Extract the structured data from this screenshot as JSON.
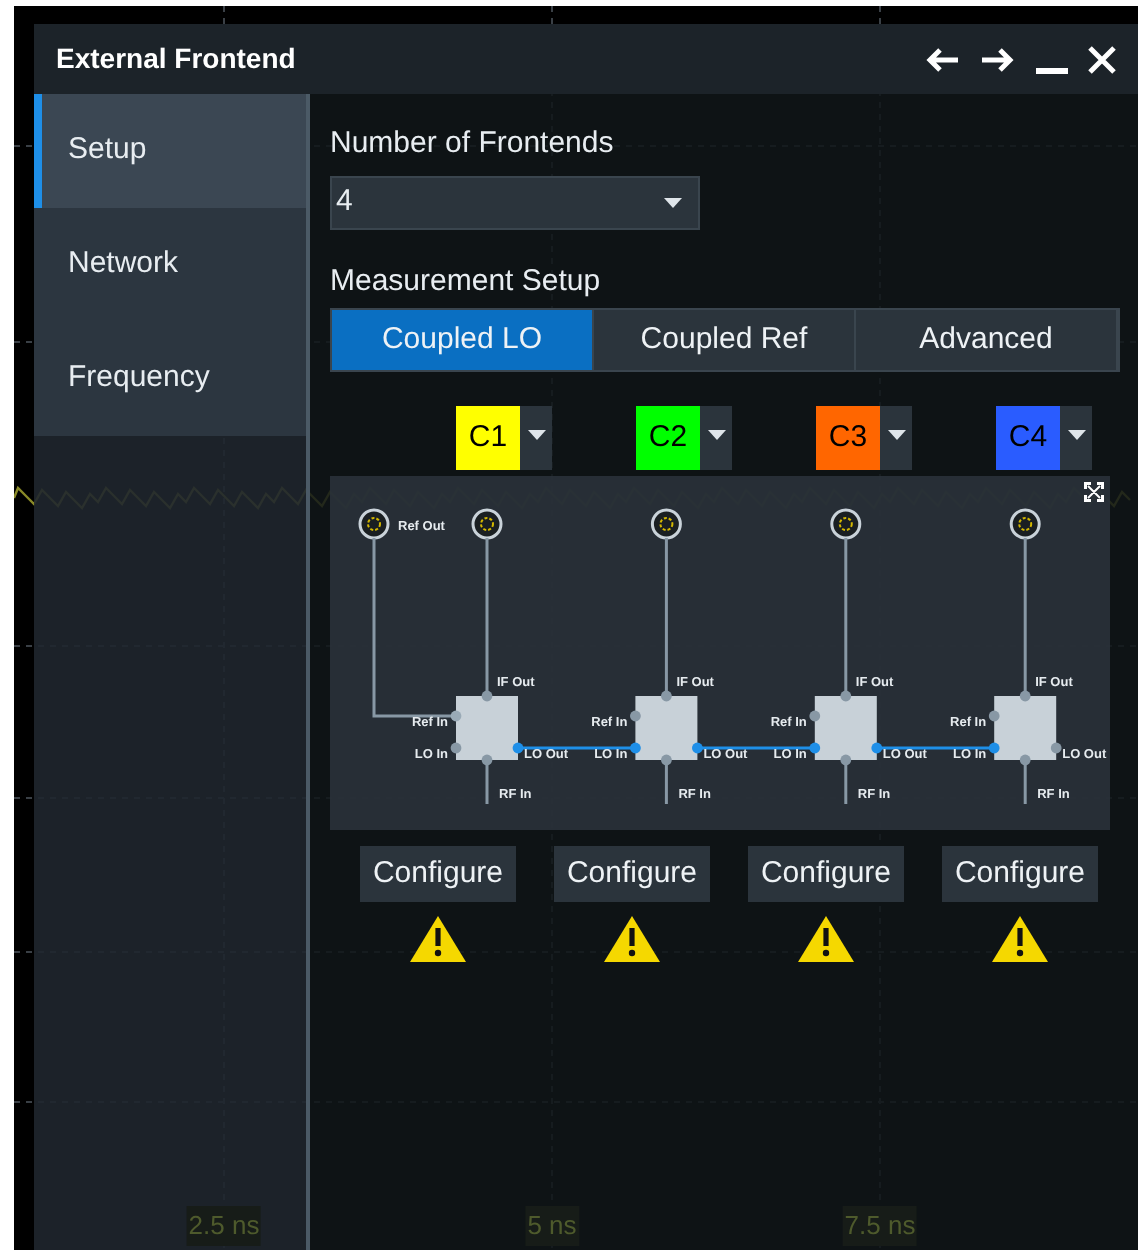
{
  "window": {
    "title": "External Frontend"
  },
  "sidebar": {
    "items": [
      {
        "label": "Setup",
        "selected": true
      },
      {
        "label": "Network",
        "selected": false
      },
      {
        "label": "Frequency",
        "selected": false
      }
    ]
  },
  "number_of_frontends": {
    "label": "Number of Frontends",
    "value": "4"
  },
  "measurement_setup": {
    "label": "Measurement Setup",
    "tabs": [
      {
        "label": "Coupled LO",
        "selected": true
      },
      {
        "label": "Coupled Ref",
        "selected": false
      },
      {
        "label": "Advanced",
        "selected": false
      }
    ]
  },
  "diagram": {
    "ref_out": "Ref Out",
    "frontends": [
      {
        "channel": "C1",
        "color": "#ffff00",
        "if_out": "IF Out",
        "ref_in": "Ref In",
        "lo_in": "LO In",
        "lo_out": "LO Out",
        "rf_in": "RF In",
        "ref_connected": true,
        "lo_out_connected": true,
        "button": "Configure",
        "warning": true
      },
      {
        "channel": "C2",
        "color": "#00ff00",
        "if_out": "IF Out",
        "ref_in": "Ref In",
        "lo_in": "LO In",
        "lo_out": "LO Out",
        "rf_in": "RF In",
        "ref_connected": false,
        "lo_out_connected": true,
        "button": "Configure",
        "warning": true
      },
      {
        "channel": "C3",
        "color": "#ff6600",
        "if_out": "IF Out",
        "ref_in": "Ref In",
        "lo_in": "LO In",
        "lo_out": "LO Out",
        "rf_in": "RF In",
        "ref_connected": false,
        "lo_out_connected": true,
        "button": "Configure",
        "warning": true
      },
      {
        "channel": "C4",
        "color": "#2a5cff",
        "if_out": "IF Out",
        "ref_in": "Ref In",
        "lo_in": "LO In",
        "lo_out": "LO Out",
        "rf_in": "RF In",
        "ref_connected": false,
        "lo_out_connected": false,
        "button": "Configure",
        "warning": true
      }
    ]
  },
  "time_axis": [
    "2.5 ns",
    "5 ns",
    "7.5 ns"
  ]
}
